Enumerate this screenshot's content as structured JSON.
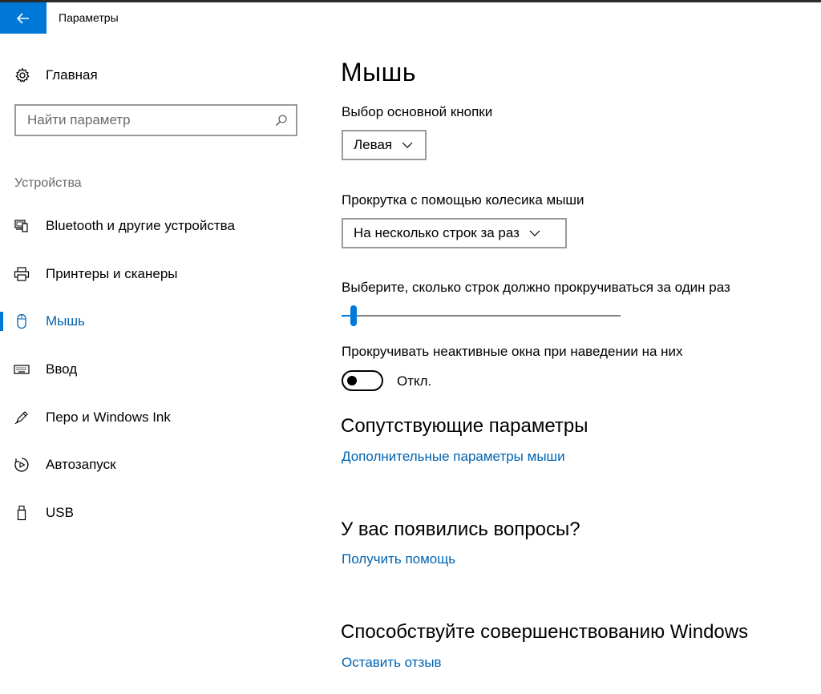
{
  "window": {
    "title": "Параметры",
    "back_icon": "back-arrow-icon",
    "accent_color": "#0078d7"
  },
  "sidebar": {
    "home_label": "Главная",
    "home_icon": "gear-icon",
    "search_placeholder": "Найти параметр",
    "search_value": "",
    "section_title": "Устройства",
    "items": [
      {
        "label": "Bluetooth и другие устройства",
        "icon": "bluetooth-devices-icon",
        "active": false
      },
      {
        "label": "Принтеры и сканеры",
        "icon": "printer-icon",
        "active": false
      },
      {
        "label": "Мышь",
        "icon": "mouse-icon",
        "active": true
      },
      {
        "label": "Ввод",
        "icon": "keyboard-icon",
        "active": false
      },
      {
        "label": "Перо и Windows Ink",
        "icon": "pen-icon",
        "active": false
      },
      {
        "label": "Автозапуск",
        "icon": "autoplay-icon",
        "active": false
      },
      {
        "label": "USB",
        "icon": "usb-icon",
        "active": false
      }
    ]
  },
  "main": {
    "title": "Мышь",
    "primary_button": {
      "label": "Выбор основной кнопки",
      "value": "Левая"
    },
    "wheel_scroll": {
      "label": "Прокрутка с помощью колесика мыши",
      "value": "На несколько строк за раз"
    },
    "lines_slider": {
      "label": "Выберите, сколько строк должно прокручиваться за один раз",
      "fraction": 0.02
    },
    "inactive_scroll": {
      "label": "Прокручивать неактивные окна при наведении на них",
      "state": "Откл.",
      "on": false
    },
    "related": {
      "heading": "Сопутствующие параметры",
      "link": "Дополнительные параметры мыши"
    },
    "questions": {
      "heading": "У вас появились вопросы?",
      "link": "Получить помощь"
    },
    "feedback": {
      "heading": "Способствуйте совершенствованию Windows",
      "link": "Оставить отзыв"
    }
  }
}
